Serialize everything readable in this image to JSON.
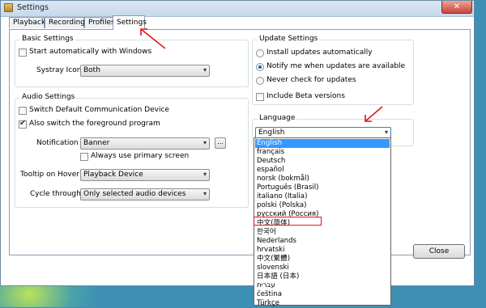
{
  "window": {
    "title": "Settings"
  },
  "tabs": [
    "Playback",
    "Recording",
    "Profiles",
    "Settings"
  ],
  "basic": {
    "title": "Basic Settings",
    "start_auto": "Start automatically with Windows",
    "systray_label": "Systray Icon",
    "systray_value": "Both"
  },
  "audio": {
    "title": "Audio Settings",
    "switch_default": "Switch Default Communication Device",
    "also_switch": "Also switch the foreground program",
    "notification_label": "Notification",
    "notification_value": "Banner",
    "browse_label": "...",
    "always_primary": "Always use primary screen",
    "tooltip_label": "Tooltip on Hover",
    "tooltip_value": "Playback Device",
    "cycle_label": "Cycle through",
    "cycle_value": "Only selected audio devices"
  },
  "update": {
    "title": "Update Settings",
    "opt_install": "Install updates automatically",
    "opt_notify": "Notify me when updates are available",
    "opt_never": "Never check for updates",
    "include_beta": "Include Beta versions"
  },
  "language": {
    "title": "Language",
    "value": "English",
    "options": [
      "English",
      "français",
      "Deutsch",
      "español",
      "norsk (bokmål)",
      "Português (Brasil)",
      "italiano (Italia)",
      "polski (Polska)",
      "русский (Россия)",
      "中文(简体)",
      "한국어",
      "Nederlands",
      "hrvatski",
      "中文(繁體)",
      "slovenski",
      "日本語 (日本)",
      "עברית",
      "čeština",
      "Türkçe"
    ]
  },
  "footer": {
    "close_label": "Close"
  },
  "colors": {
    "annotation": "#e0161d",
    "selection": "#3399ff",
    "desktop": "#3d8fb3"
  }
}
